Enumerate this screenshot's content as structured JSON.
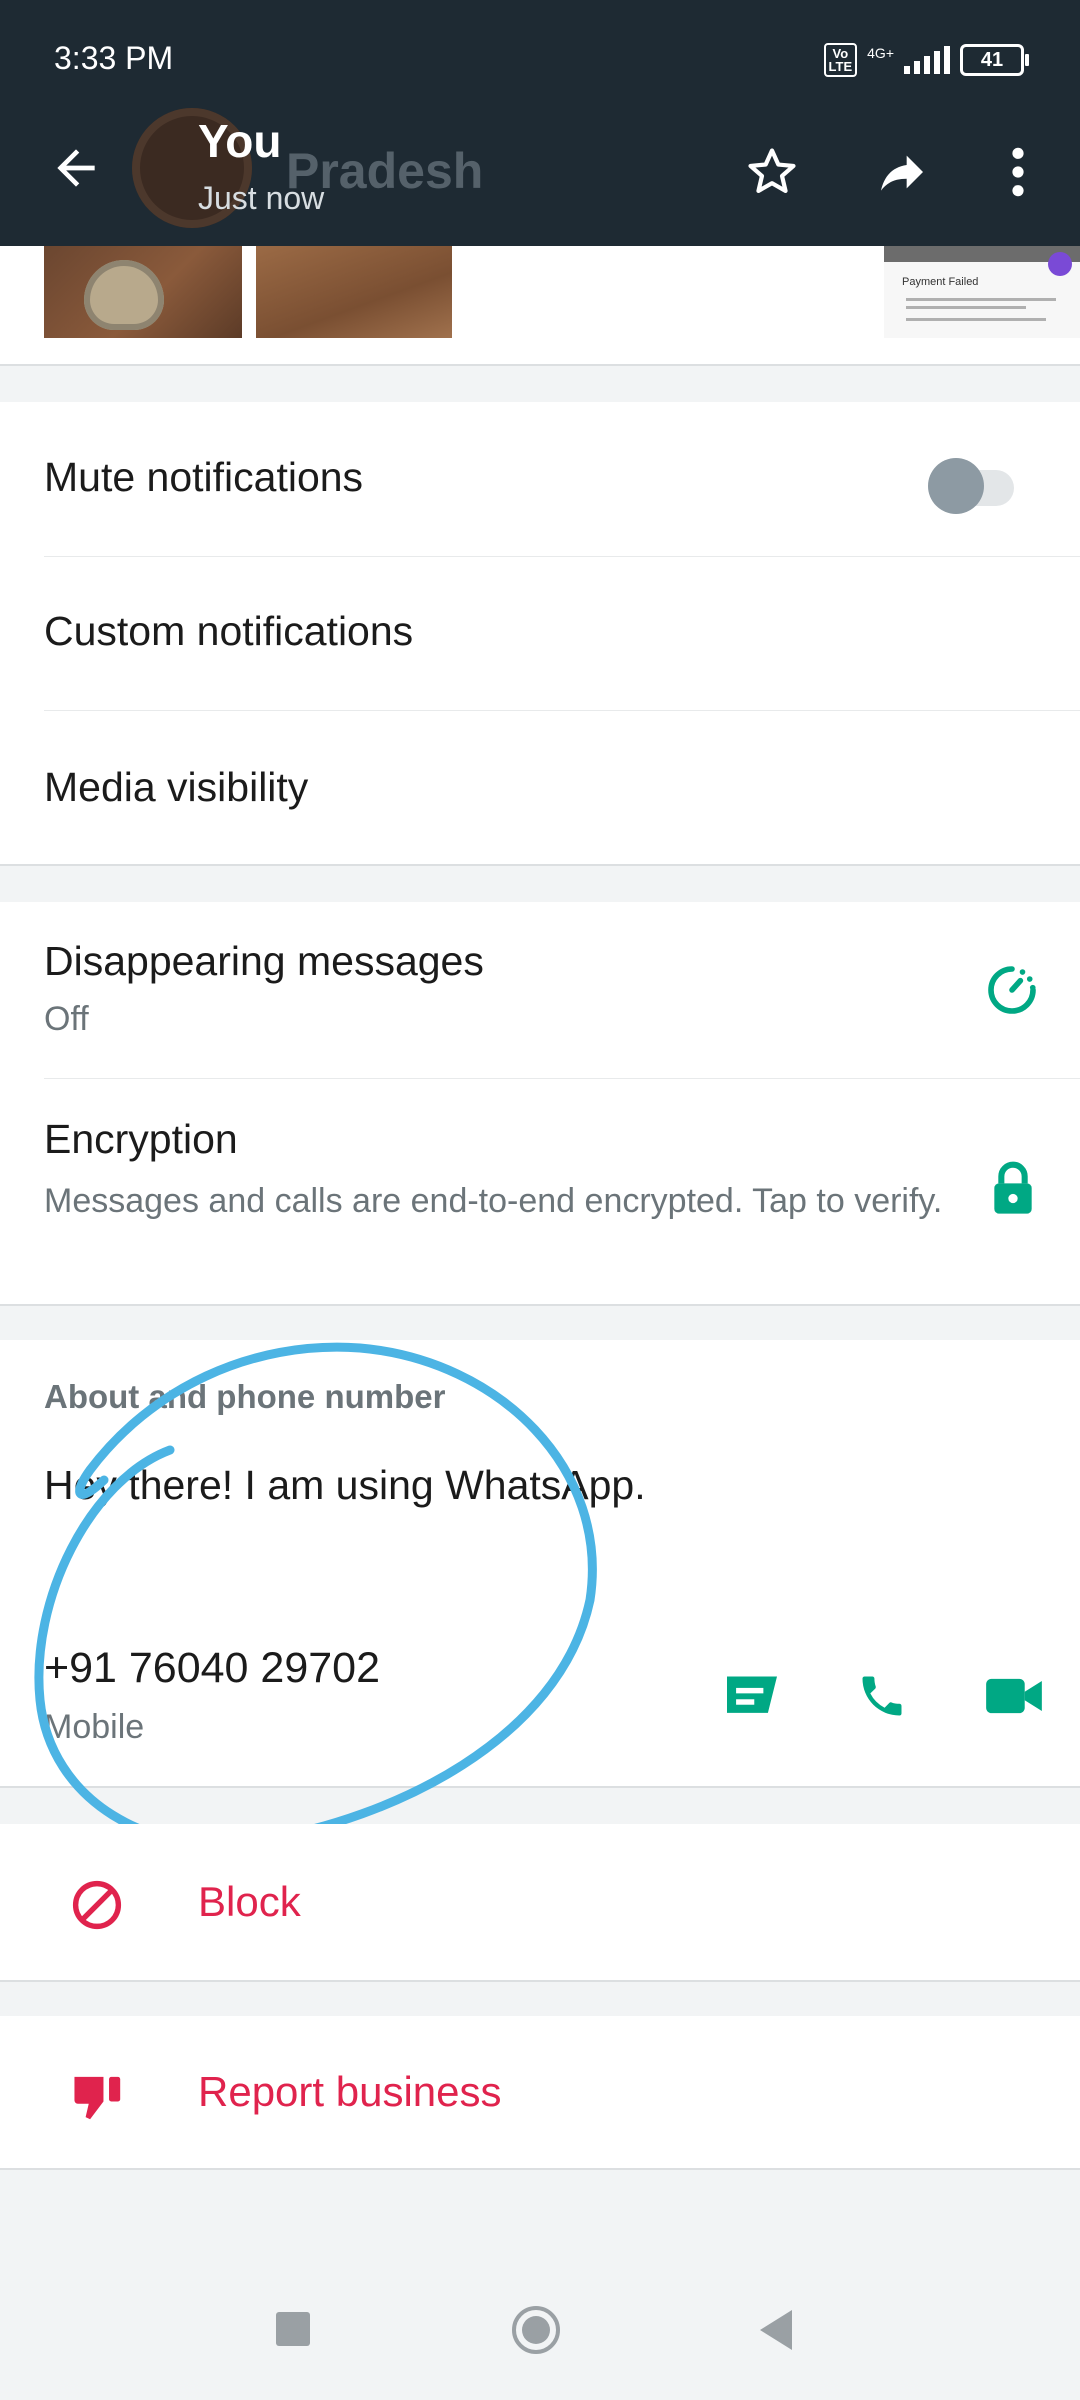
{
  "status_bar": {
    "time": "3:33 PM",
    "volte_label": "Vo\nLTE",
    "network": "4G+",
    "battery": "41"
  },
  "header": {
    "contact_name": "You",
    "last_seen": "Just now",
    "background_name": "Pradesh"
  },
  "media": {
    "doc_title": "Payment Failed"
  },
  "settings": {
    "mute_notifications": "Mute notifications",
    "mute_state": "off",
    "custom_notifications": "Custom notifications",
    "media_visibility": "Media visibility"
  },
  "privacy": {
    "disappearing_title": "Disappearing messages",
    "disappearing_value": "Off",
    "encryption_title": "Encryption",
    "encryption_desc": "Messages and calls are end-to-end encrypted. Tap to verify."
  },
  "about": {
    "section_title": "About and phone number",
    "about_text": "Hey there! I am using WhatsApp.",
    "phone_number": "+91 76040 29702",
    "phone_type": "Mobile"
  },
  "actions": {
    "block": "Block",
    "report": "Report business"
  },
  "colors": {
    "header_bg": "#1e2a33",
    "accent_green": "#00a884",
    "danger_red": "#e0234d",
    "annotation_blue": "#4cb4e4"
  }
}
